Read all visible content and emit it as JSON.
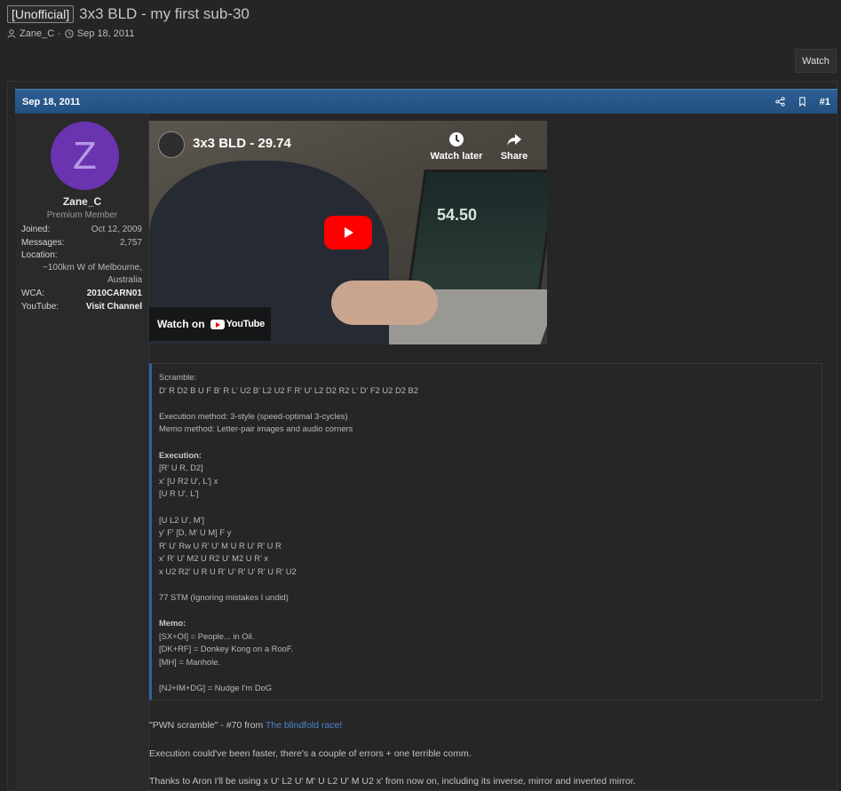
{
  "thread": {
    "prefix": "[Unofficial]",
    "title": "3x3 BLD - my first sub-30",
    "author": "Zane_C",
    "separator": "·",
    "date": "Sep 18, 2011",
    "watch_label": "Watch"
  },
  "post": {
    "date": "Sep 18, 2011",
    "number": "#1",
    "user": {
      "avatar_letter": "Z",
      "name": "Zane_C",
      "title": "Premium Member",
      "joined_label": "Joined:",
      "joined": "Oct 12, 2009",
      "messages_label": "Messages:",
      "messages": "2,757",
      "location_label": "Location:",
      "location_line1": "~100km W of Melbourne,",
      "location_line2": "Australia",
      "wca_label": "WCA:",
      "wca": "2010CARN01",
      "youtube_label": "YouTube:",
      "youtube": "Visit Channel"
    },
    "video": {
      "title": "3x3 BLD - 29.74",
      "watch_later": "Watch later",
      "share": "Share",
      "watch_on": "Watch on",
      "yt_brand": "YouTube",
      "timer_readout": "54.50"
    },
    "code_lines": [
      "Scramble:",
      "D' R D2 B U F B' R L' U2 B' L2 U2 F R' U' L2 D2 R2 L' D' F2 U2 D2 B2",
      "",
      "Execution method: 3-style (speed-optimal 3-cycles)",
      "Memo method: Letter-pair images and audio corners",
      "",
      "Execution:",
      "[R' U R, D2]",
      "x' [U R2 U', L'] x",
      "[U R U', L']",
      "",
      "[U L2 U', M']",
      "y' F' [D, M' U M] F y",
      "R' U' Rw U R' U' M U R U' R' U R",
      "x' R' U' M2 U R2 U' M2 U R' x",
      "x U2 R2' U R U R' U' R' U' R' U R' U2",
      "",
      "77 STM (Ignoring mistakes I undid)",
      "",
      "Memo:",
      "[SX+OI] = People... in Oil.",
      "[DK+RF] = Donkey Kong on a RooF.",
      "[MH] = Manhole.",
      "",
      "[NJ+IM+DG] = Nudge I'm DoG"
    ],
    "pwn_prefix": "\"PWN scramble\" - #70 from ",
    "pwn_link": "The blindfold race!",
    "paragraph1": "Execution could've been faster, there's a couple of errors + one terrible comm.",
    "paragraph2": "Thanks to Aron I'll be using x U' L2 U' M' U L2 U' M U2 x' from now on, including its inverse, mirror and inverted mirror."
  },
  "colors": {
    "header_blue": "#2d5f95",
    "link_blue": "#4c88cf",
    "avatar_purple": "#6a33b0",
    "youtube_red": "#ff0000"
  }
}
